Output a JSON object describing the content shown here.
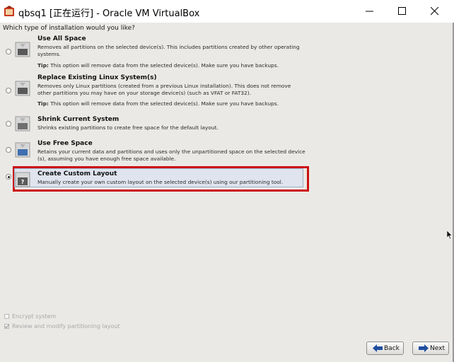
{
  "window": {
    "title": "qbsq1 [正在运行] - Oracle VM VirtualBox",
    "icon": "virtualbox-icon"
  },
  "installer": {
    "question": "Which type of installation would you like?",
    "options": [
      {
        "title": "Use All Space",
        "description": "Removes all partitions on the selected device(s).  This includes partitions created by other operating systems.",
        "tip_label": "Tip:",
        "tip_text": "This option will remove data from the selected device(s).  Make sure you have backups.",
        "selected": false
      },
      {
        "title": "Replace Existing Linux System(s)",
        "description": "Removes only Linux partitions (created from a previous Linux installation).  This does not remove other partitions you may have on your storage device(s) (such as VFAT or FAT32).",
        "tip_label": "Tip:",
        "tip_text": "This option will remove data from the selected device(s).  Make sure you have backups.",
        "selected": false
      },
      {
        "title": "Shrink Current System",
        "description": "Shrinks existing partitions to create free space for the default layout.",
        "selected": false
      },
      {
        "title": "Use Free Space",
        "description": "Retains your current data and partitions and uses only the unpartitioned space on the selected device (s), assuming you have enough free space available.",
        "selected": false
      },
      {
        "title": "Create Custom Layout",
        "description": "Manually create your own custom layout on the selected device(s) using our partitioning tool.",
        "selected": true
      }
    ],
    "checkboxes": [
      {
        "label": "Encrypt system",
        "checked": false,
        "enabled": false
      },
      {
        "label": "Review and modify partitioning layout",
        "checked": true,
        "enabled": false
      }
    ],
    "buttons": {
      "back": "Back",
      "next": "Next"
    }
  },
  "colors": {
    "highlight_border": "#cc1111",
    "selected_fill": "#dfe4ee",
    "background": "#ebe9e6",
    "nav_arrow": "#1f4f9e"
  }
}
